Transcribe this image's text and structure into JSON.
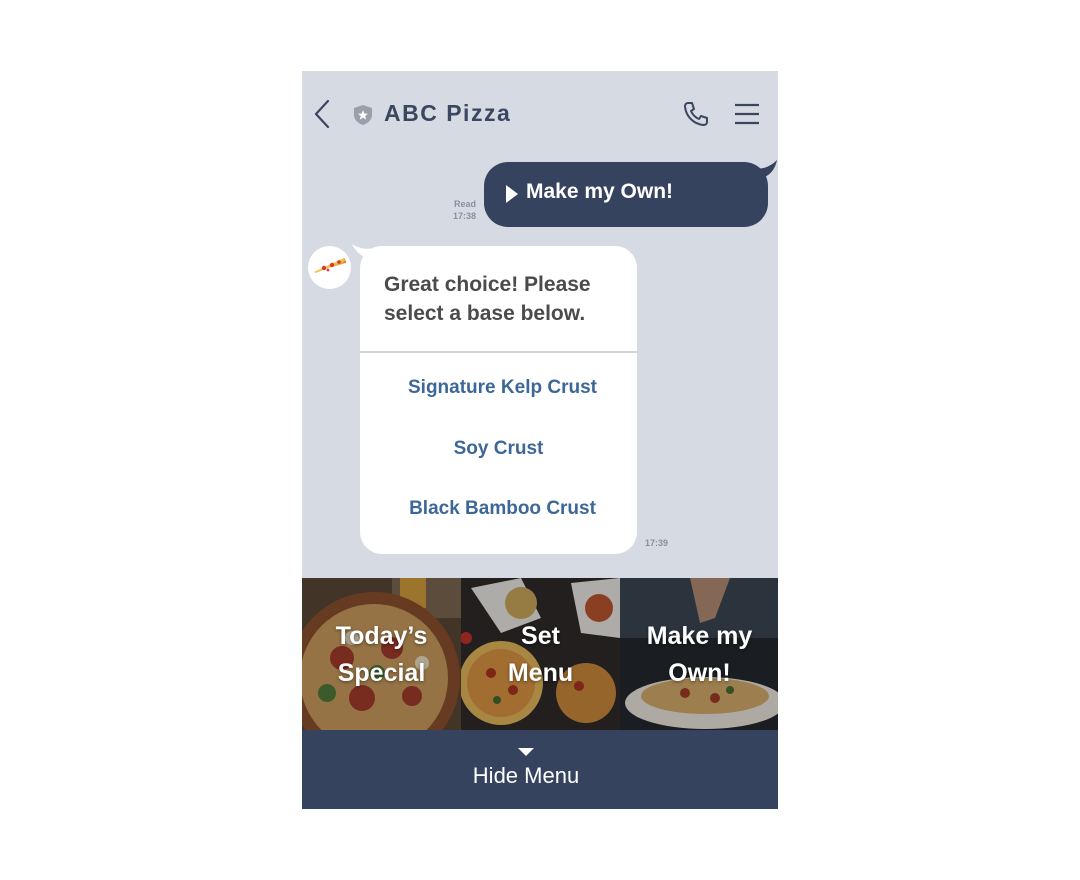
{
  "header": {
    "title": "ABC Pizza",
    "icons": [
      "chevron-left-icon",
      "shield-star-icon",
      "phone-icon",
      "hamburger-menu-icon"
    ]
  },
  "messages": {
    "user": {
      "text": "Make my Own!",
      "read_label": "Read",
      "time": "17:38"
    },
    "bot": {
      "text": "Great choice! Please select a base below.",
      "options": [
        "Signature Kelp Crust",
        "Soy Crust",
        "Black Bamboo Crust"
      ],
      "time": "17:39"
    }
  },
  "rich_menu": {
    "tiles": [
      {
        "label": "Today’s\nSpecial"
      },
      {
        "label": "Set\nMenu"
      },
      {
        "label": "Make my\nOwn!"
      }
    ],
    "hide_label": "Hide Menu"
  },
  "colors": {
    "background": "#d6dae3",
    "bubble_dark": "#36435f",
    "option_link": "#3d6799",
    "title": "#3b4660"
  }
}
